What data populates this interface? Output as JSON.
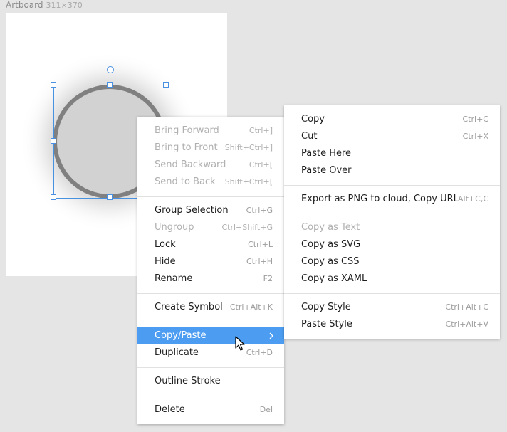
{
  "artboard": {
    "name": "Artboard",
    "size": "311×370"
  },
  "context_menu": {
    "items": [
      {
        "label": "Bring Forward",
        "shortcut": "Ctrl+]",
        "enabled": false
      },
      {
        "label": "Bring to Front",
        "shortcut": "Shift+Ctrl+]",
        "enabled": false
      },
      {
        "label": "Send Backward",
        "shortcut": "Ctrl+[",
        "enabled": false
      },
      {
        "label": "Send to Back",
        "shortcut": "Shift+Ctrl+[",
        "enabled": false
      },
      {
        "label": "Group Selection",
        "shortcut": "Ctrl+G",
        "enabled": true
      },
      {
        "label": "Ungroup",
        "shortcut": "Ctrl+Shift+G",
        "enabled": false
      },
      {
        "label": "Lock",
        "shortcut": "Ctrl+L",
        "enabled": true
      },
      {
        "label": "Hide",
        "shortcut": "Ctrl+H",
        "enabled": true
      },
      {
        "label": "Rename",
        "shortcut": "F2",
        "enabled": true
      },
      {
        "label": "Create Symbol",
        "shortcut": "Ctrl+Alt+K",
        "enabled": true
      },
      {
        "label": "Copy/Paste",
        "shortcut": "",
        "enabled": true,
        "highlighted": true,
        "submenu_icon": "chevron-right-icon"
      },
      {
        "label": "Duplicate",
        "shortcut": "Ctrl+D",
        "enabled": true
      },
      {
        "label": "Outline Stroke",
        "shortcut": "",
        "enabled": true
      },
      {
        "label": "Delete",
        "shortcut": "Del",
        "enabled": true
      }
    ]
  },
  "submenu": {
    "items": [
      {
        "label": "Copy",
        "shortcut": "Ctrl+C",
        "enabled": true
      },
      {
        "label": "Cut",
        "shortcut": "Ctrl+X",
        "enabled": true
      },
      {
        "label": "Paste Here",
        "shortcut": "",
        "enabled": true
      },
      {
        "label": "Paste Over",
        "shortcut": "",
        "enabled": true
      },
      {
        "label": "Export as PNG to cloud, Copy URL",
        "shortcut": "Alt+C,C",
        "enabled": true
      },
      {
        "label": "Copy as Text",
        "shortcut": "",
        "enabled": false
      },
      {
        "label": "Copy as SVG",
        "shortcut": "",
        "enabled": true
      },
      {
        "label": "Copy as CSS",
        "shortcut": "",
        "enabled": true
      },
      {
        "label": "Copy as XAML",
        "shortcut": "",
        "enabled": true
      },
      {
        "label": "Copy Style",
        "shortcut": "Ctrl+Alt+C",
        "enabled": true
      },
      {
        "label": "Paste Style",
        "shortcut": "Ctrl+Alt+V",
        "enabled": true
      }
    ]
  },
  "colors": {
    "highlight": "#4c9df1",
    "selection": "#4a90e2",
    "ellipse_stroke": "#808080",
    "ellipse_fill": "#d2d2d2"
  },
  "cursor_icon": "arrow-cursor-icon"
}
